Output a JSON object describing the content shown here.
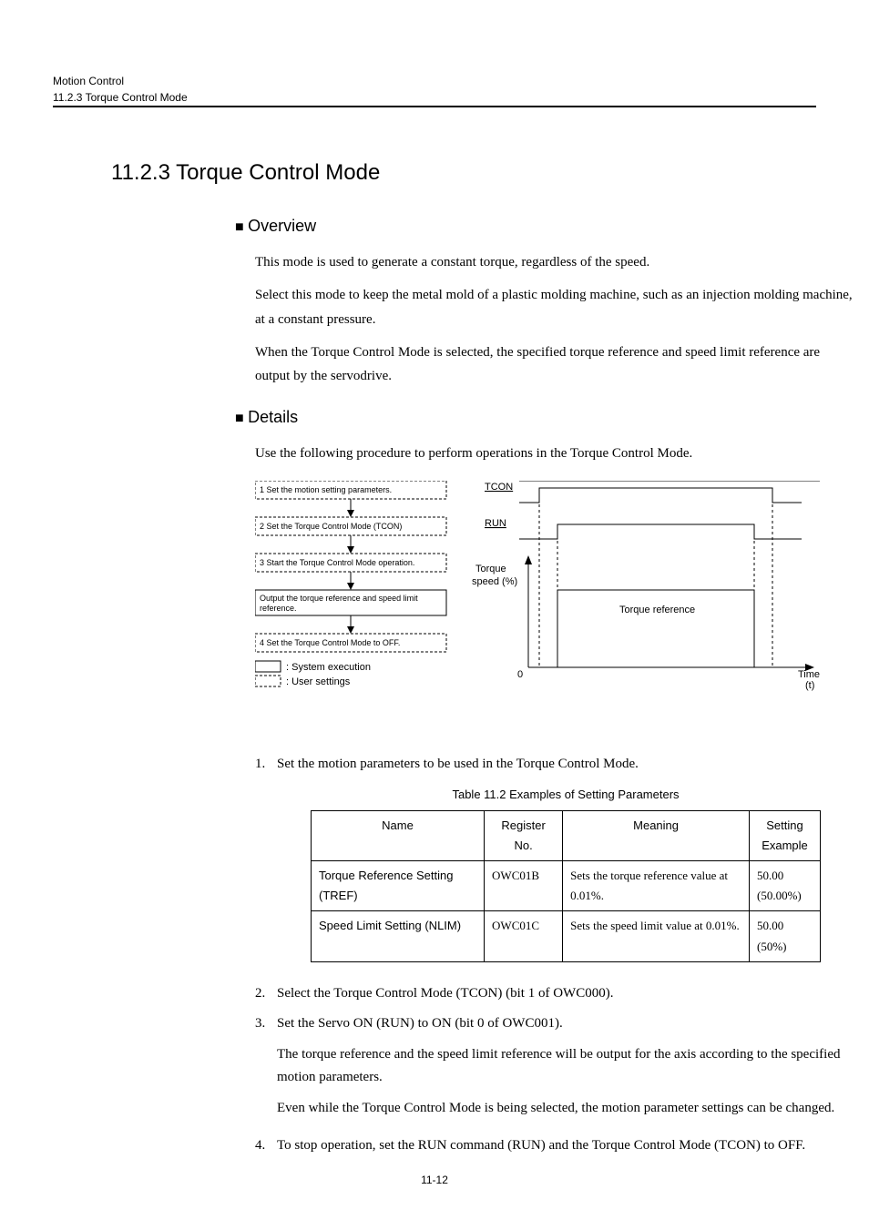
{
  "header": {
    "chapter": "Motion Control",
    "section": "11.2.3  Torque Control Mode"
  },
  "title": "11.2.3  Torque Control Mode",
  "overview": {
    "heading": "Overview",
    "p1": "This mode is used to generate a constant torque, regardless of the speed.",
    "p2": "Select this mode to keep the metal mold of a plastic molding machine, such as an injection molding machine, at a constant pressure.",
    "p3": "When the Torque Control Mode is selected, the specified torque reference and speed limit reference are output by the servodrive."
  },
  "details": {
    "heading": "Details",
    "intro": "Use the following procedure to perform operations in the Torque Control Mode."
  },
  "diagram": {
    "step1": "1 Set the motion setting parameters.",
    "step2": "2 Set the Torque Control Mode (TCON)",
    "step3": "3 Start the Torque Control Mode operation.",
    "step_output": "Output the torque reference and speed limit reference.",
    "step4": "4 Set the Torque Control Mode to OFF.",
    "legend_sys": ": System execution",
    "legend_user": ": User settings",
    "tcon": "TCON",
    "run": "RUN",
    "ylabel1": "Torque",
    "ylabel2": "speed (%)",
    "annot": "Torque reference",
    "zero": "0",
    "xlabel1": "Time",
    "xlabel2": "(t)"
  },
  "steps": {
    "s1": "Set the motion parameters to be used in the Torque Control Mode.",
    "caption": "Table 11.2  Examples of Setting Parameters",
    "th_name": "Name",
    "th_reg": "Register No.",
    "th_meaning": "Meaning",
    "th_ex": "Setting Example",
    "r1_name": "Torque Reference Setting (TREF)",
    "r1_reg": "OWC01B",
    "r1_meaning": "Sets the torque reference value at 0.01%.",
    "r1_ex1": "50.00",
    "r1_ex2": "(50.00%)",
    "r2_name": "Speed Limit Setting (NLIM)",
    "r2_reg": "OWC01C",
    "r2_meaning": "Sets the speed limit value at 0.01%.",
    "r2_ex1": "50.00",
    "r2_ex2": "(50%)",
    "s2": "Select the Torque Control Mode (TCON) (bit 1 of OWC000).",
    "s3": "Set the Servo ON (RUN) to ON (bit 0 of OWC001).",
    "s3_p1": "The torque reference and the speed limit reference will be output for the axis according to the specified motion parameters.",
    "s3_p2": "Even while the Torque Control Mode is being selected, the motion parameter settings can be changed.",
    "s4": "To stop operation, set the RUN command (RUN) and the Torque Control Mode (TCON) to OFF."
  },
  "page_number": "11-12",
  "chart_data": {
    "type": "flowchart+timing",
    "flow_steps": [
      {
        "id": 1,
        "label": "Set the motion setting parameters.",
        "kind": "user"
      },
      {
        "id": 2,
        "label": "Set the Torque Control Mode (TCON)",
        "kind": "user"
      },
      {
        "id": 3,
        "label": "Start the Torque Control Mode operation.",
        "kind": "user"
      },
      {
        "id": 4,
        "label": "Output the torque reference and speed limit reference.",
        "kind": "system"
      },
      {
        "id": 5,
        "label": "Set the Torque Control Mode to OFF.",
        "kind": "user"
      }
    ],
    "legend": [
      {
        "box": "solid",
        "label": "System execution"
      },
      {
        "box": "dashed",
        "label": "User settings"
      }
    ],
    "timing": {
      "signals": [
        {
          "name": "TCON",
          "levels": [
            {
              "from": 0,
              "to": 0.08,
              "value": 0
            },
            {
              "from": 0.08,
              "to": 0.92,
              "value": 1
            },
            {
              "from": 0.92,
              "to": 1.0,
              "value": 0
            }
          ]
        },
        {
          "name": "RUN",
          "levels": [
            {
              "from": 0,
              "to": 0.15,
              "value": 0
            },
            {
              "from": 0.15,
              "to": 0.85,
              "value": 1
            },
            {
              "from": 0.85,
              "to": 1.0,
              "value": 0
            }
          ]
        }
      ],
      "analog": {
        "name": "Torque speed (%)",
        "baseline": 0,
        "trace": [
          {
            "from": 0,
            "to": 0.15,
            "value": 0
          },
          {
            "from": 0.15,
            "to": 0.85,
            "value": 1.0
          },
          {
            "from": 0.85,
            "to": 1.0,
            "value": 0
          }
        ],
        "annotation": "Torque reference"
      },
      "xlabel": "Time (t)"
    }
  }
}
